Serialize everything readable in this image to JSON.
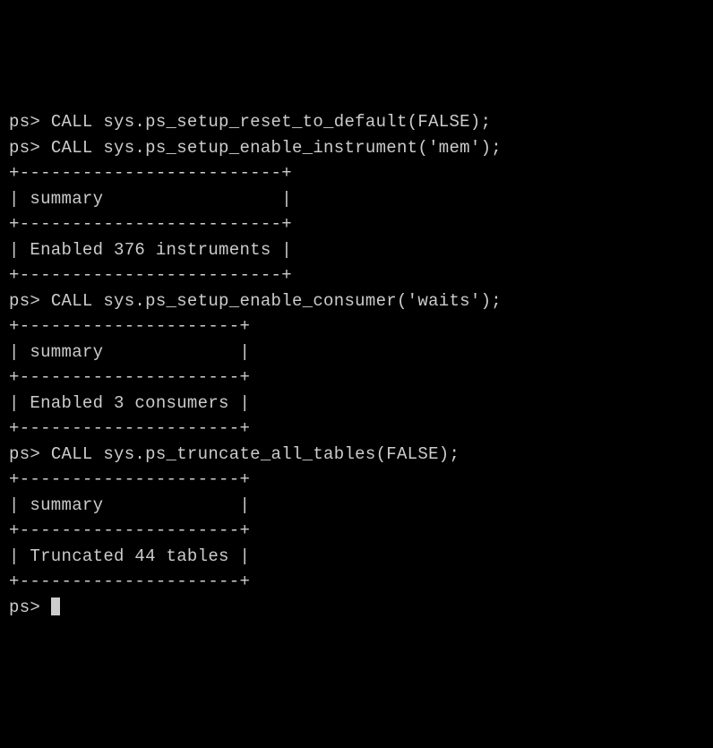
{
  "prompt": "ps>",
  "commands": {
    "cmd1": "CALL sys.ps_setup_reset_to_default(FALSE);",
    "cmd2": "CALL sys.ps_setup_enable_instrument('mem');",
    "cmd3": "CALL sys.ps_setup_enable_consumer('waits');",
    "cmd4": "CALL sys.ps_truncate_all_tables(FALSE);"
  },
  "tables": {
    "table1": {
      "border": "+-------------------------+",
      "header": "| summary                 |",
      "row": "| Enabled 376 instruments |"
    },
    "table2": {
      "border": "+---------------------+",
      "header": "| summary             |",
      "row": "| Enabled 3 consumers |"
    },
    "table3": {
      "border": "+---------------------+",
      "header": "| summary             |",
      "row": "| Truncated 44 tables |"
    }
  }
}
